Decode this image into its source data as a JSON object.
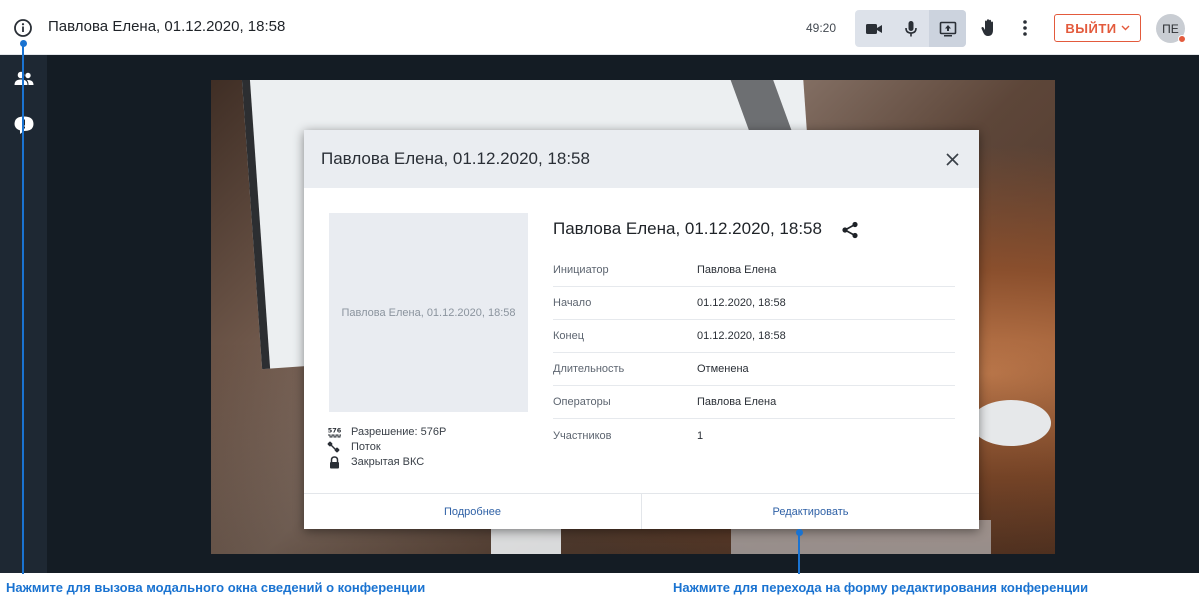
{
  "topbar": {
    "title": "Павлова Елена, 01.12.2020, 18:58",
    "timer": "49:20",
    "exit_label": "ВЫЙТИ",
    "avatar_initials": "ПЕ"
  },
  "modal": {
    "header_title": "Павлова Елена, 01.12.2020, 18:58",
    "preview_label": "Павлова Елена, 01.12.2020, 18:58",
    "meta": {
      "resolution_badge": "576",
      "resolution": "Разрешение: 576P",
      "stream": "Поток",
      "closed": "Закрытая ВКС"
    },
    "detail_title": "Павлова Елена, 01.12.2020, 18:58",
    "rows": [
      {
        "key": "Инициатор",
        "value": "Павлова Елена"
      },
      {
        "key": "Начало",
        "value": "01.12.2020, 18:58"
      },
      {
        "key": "Конец",
        "value": "01.12.2020, 18:58"
      },
      {
        "key": "Длительность",
        "value": "Отменена"
      },
      {
        "key": "Операторы",
        "value": "Павлова Елена"
      },
      {
        "key": "Участников",
        "value": "1"
      }
    ],
    "footer": {
      "details_label": "Подробнее",
      "edit_label": "Редактировать"
    }
  },
  "annotations": {
    "info_hint": "Нажмите для вызова модального окна сведений о конференции",
    "edit_hint": "Нажмите для перехода на форму редактирования конференции"
  },
  "colors": {
    "accent": "#1a73d1",
    "exit": "#e35a3c",
    "sidebar": "#1e2833",
    "stage": "#141c24",
    "link": "#2f61a6"
  },
  "icons": [
    "info-icon",
    "camera-icon",
    "microphone-icon",
    "screen-share-icon",
    "hand-icon",
    "more-vertical-icon",
    "chevron-down-icon",
    "participants-icon",
    "chat-icon",
    "close-icon",
    "share-icon",
    "resolution-icon",
    "stream-icon",
    "lock-icon"
  ]
}
